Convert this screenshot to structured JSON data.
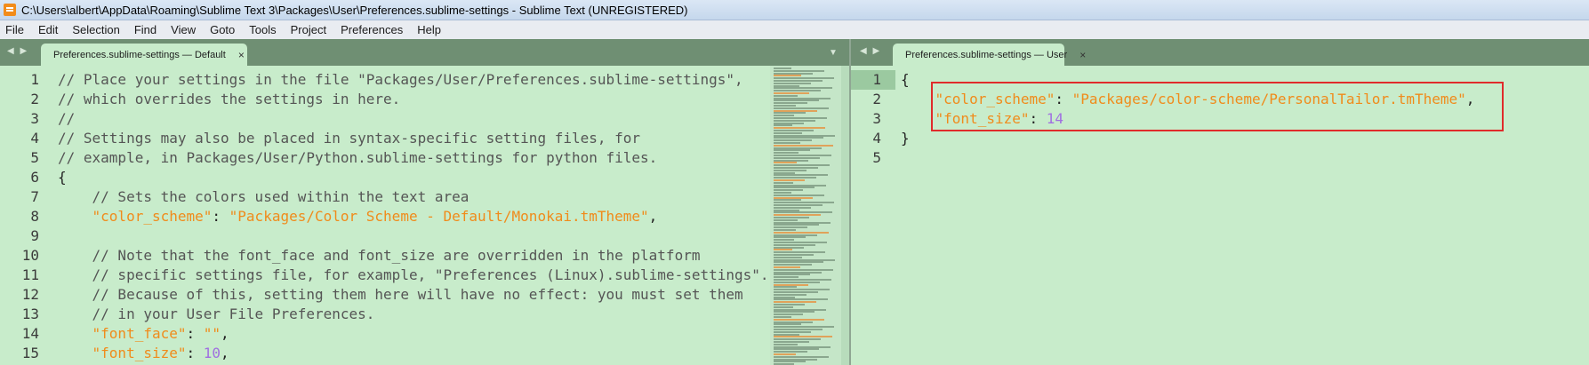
{
  "window": {
    "title": "C:\\Users\\albert\\AppData\\Roaming\\Sublime Text 3\\Packages\\User\\Preferences.sublime-settings - Sublime Text (UNREGISTERED)"
  },
  "menu": [
    "File",
    "Edit",
    "Selection",
    "Find",
    "View",
    "Goto",
    "Tools",
    "Project",
    "Preferences",
    "Help"
  ],
  "left_pane": {
    "nav_arrows": "◀ ▶",
    "tab_label": "Preferences.sublime-settings — Default",
    "tab_close": "×",
    "dropdown": "▼",
    "line_numbers": [
      "1",
      "2",
      "3",
      "4",
      "5",
      "6",
      "7",
      "8",
      "9",
      "10",
      "11",
      "12",
      "13",
      "14",
      "15"
    ],
    "lines": [
      "// Place your settings in the file \"Packages/User/Preferences.sublime-settings\",",
      "// which overrides the settings in here.",
      "//",
      "// Settings may also be placed in syntax-specific setting files, for",
      "// example, in Packages/User/Python.sublime-settings for python files.",
      "{",
      "    // Sets the colors used within the text area",
      {
        "key": "\"color_scheme\"",
        "sep": ": ",
        "value": "\"Packages/Color Scheme - Default/Monokai.tmTheme\"",
        "end": ","
      },
      "",
      "    // Note that the font_face and font_size are overridden in the platform",
      "    // specific settings file, for example, \"Preferences (Linux).sublime-settings\".",
      "    // Because of this, setting them here will have no effect: you must set them",
      "    // in your User File Preferences.",
      {
        "key": "\"font_face\"",
        "sep": ": ",
        "value": "\"\"",
        "end": ","
      },
      {
        "key": "\"font_size\"",
        "sep": ": ",
        "num": "10",
        "end": ","
      }
    ]
  },
  "right_pane": {
    "nav_arrows": "◀ ▶",
    "tab_label": "Preferences.sublime-settings — User",
    "tab_close": "×",
    "line_numbers": [
      "1",
      "2",
      "3",
      "4",
      "5"
    ],
    "lines": [
      "{",
      {
        "key": "\"color_scheme\"",
        "sep": ": ",
        "value": "\"Packages/color-scheme/PersonalTailor.tmTheme\"",
        "end": ","
      },
      {
        "key": "\"font_size\"",
        "sep": ": ",
        "num": "14",
        "end": ""
      },
      "}",
      ""
    ]
  },
  "colors": {
    "background": "#c8eccb",
    "string": "#f08b1b",
    "number": "#a070e0",
    "highlight_border": "#e02b2b"
  }
}
